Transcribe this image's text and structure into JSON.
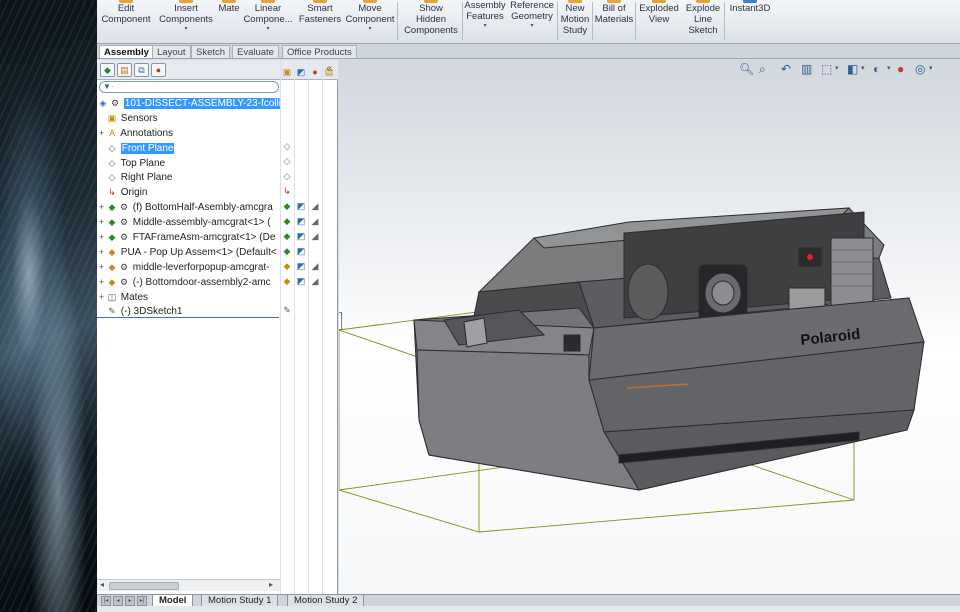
{
  "ribbon": {
    "buttons": [
      {
        "label": "Edit\nComponent",
        "dropdown": false
      },
      {
        "label": "Insert\nComponents",
        "dropdown": true
      },
      {
        "label": "Mate",
        "dropdown": false
      },
      {
        "label": "Linear\nCompone...",
        "dropdown": true
      },
      {
        "label": "Smart\nFasteners",
        "dropdown": false
      },
      {
        "label": "Move\nComponent",
        "dropdown": true
      },
      {
        "label": "Show\nHidden\nComponents",
        "dropdown": false
      },
      {
        "label": "Assembly\nFeatures",
        "dropdown": true
      },
      {
        "label": "Reference\nGeometry",
        "dropdown": true
      },
      {
        "label": "New\nMotion\nStudy",
        "dropdown": false
      },
      {
        "label": "Bill of\nMaterials",
        "dropdown": false
      },
      {
        "label": "Exploded\nView",
        "dropdown": false
      },
      {
        "label": "Explode\nLine\nSketch",
        "dropdown": false
      },
      {
        "label": "Instant3D",
        "dropdown": false
      }
    ]
  },
  "command_tabs": [
    "Assembly",
    "Layout",
    "Sketch",
    "Evaluate",
    "Office Products"
  ],
  "command_tabs_active": "Assembly",
  "feature_tree": {
    "root": "101-DISSECT-ASSEMBLY-23-fcollin",
    "items": [
      {
        "label": "Sensors",
        "icon": "sensor-icon",
        "expander": ""
      },
      {
        "label": "Annotations",
        "icon": "annotation-icon",
        "expander": "+"
      },
      {
        "label": "Front Plane",
        "icon": "plane-icon",
        "expander": ""
      },
      {
        "label": "Top Plane",
        "icon": "plane-icon",
        "expander": ""
      },
      {
        "label": "Right Plane",
        "icon": "plane-icon",
        "expander": ""
      },
      {
        "label": "Origin",
        "icon": "origin-icon",
        "expander": ""
      },
      {
        "label": "(f) BottomHalf-Asembly-amcgra",
        "icon": "subassembly-icon",
        "expander": "+"
      },
      {
        "label": "Middle-assembly-amcgrat<1> (",
        "icon": "subassembly-icon",
        "expander": "+"
      },
      {
        "label": "FTAFrameAsm-amcgrat<1> (De",
        "icon": "subassembly-icon",
        "expander": "+"
      },
      {
        "label": "PUA - Pop Up Assem<1> (Default<",
        "icon": "subassembly-icon",
        "expander": "+"
      },
      {
        "label": "middle-leverforpopup-amcgrat-",
        "icon": "subassembly-icon",
        "expander": "+"
      },
      {
        "label": "(-) Bottomdoor-assembly2-amc",
        "icon": "subassembly-icon",
        "expander": "+"
      },
      {
        "label": "Mates",
        "icon": "mates-icon",
        "expander": "+"
      },
      {
        "label": "(-) 3DSketch1",
        "icon": "sketch3d-icon",
        "expander": ""
      }
    ],
    "highlighted": "Front Plane"
  },
  "model_tabs": [
    "Model",
    "Motion Study 1",
    "Motion Study 2"
  ],
  "model_tabs_active": "Model",
  "viewport": {
    "logo_text": "Polaroid"
  },
  "colors": {
    "selection": "#3399ff",
    "bbox_line": "#8a8a1a",
    "camera_body": "#6f7072"
  }
}
